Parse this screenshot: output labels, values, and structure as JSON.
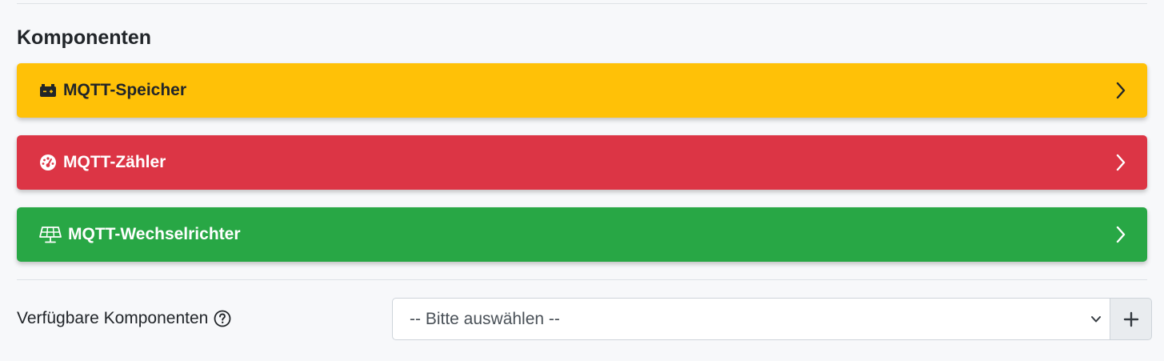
{
  "section": {
    "title": "Komponenten"
  },
  "components": [
    {
      "label": "MQTT-Speicher",
      "icon": "battery-icon",
      "color": "#ffc107",
      "text_color": "#212529"
    },
    {
      "label": "MQTT-Zähler",
      "icon": "gauge-icon",
      "color": "#dc3545",
      "text_color": "#ffffff"
    },
    {
      "label": "MQTT-Wechselrichter",
      "icon": "solar-panel-icon",
      "color": "#28a745",
      "text_color": "#ffffff"
    }
  ],
  "available": {
    "label": "Verfügbare Komponenten",
    "help_icon": "question-circle-icon",
    "select_value": "-- Bitte auswählen --",
    "add_icon": "plus-icon"
  }
}
